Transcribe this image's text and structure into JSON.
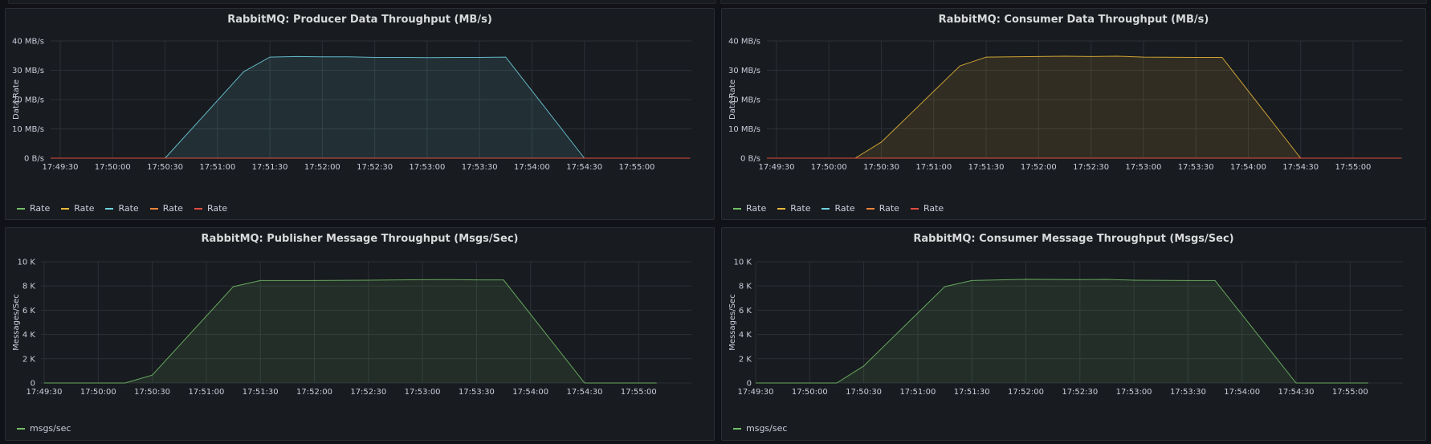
{
  "panels": [
    {
      "title": "RabbitMQ: Producer Data Throughput (MB/s)",
      "chart_data": {
        "type": "area",
        "ylabel": "Data Rate",
        "ylim": [
          0,
          40
        ],
        "y_ticks": [
          0,
          10,
          20,
          30,
          40
        ],
        "y_tick_labels": [
          "0 B/s",
          "10 MB/s",
          "20 MB/s",
          "30 MB/s",
          "40 MB/s"
        ],
        "x_tick_labels": [
          "17:49:30",
          "17:50:00",
          "17:50:30",
          "17:51:00",
          "17:51:30",
          "17:52:00",
          "17:52:30",
          "17:53:00",
          "17:53:30",
          "17:54:00",
          "17:54:30",
          "17:55:00"
        ],
        "series": [
          {
            "name": "Rate",
            "color": "#73bf69",
            "fill": false,
            "points": []
          },
          {
            "name": "Rate",
            "color": "#eab839",
            "fill": false,
            "points": []
          },
          {
            "name": "Rate",
            "color": "#6ed0e0",
            "fill": true,
            "points": [
              [
                "17:50:30",
                0
              ],
              [
                "17:51:15",
                29.5
              ],
              [
                "17:51:30",
                34.5
              ],
              [
                "17:51:45",
                34.7
              ],
              [
                "17:52:00",
                34.6
              ],
              [
                "17:52:15",
                34.6
              ],
              [
                "17:52:30",
                34.4
              ],
              [
                "17:52:45",
                34.4
              ],
              [
                "17:53:00",
                34.3
              ],
              [
                "17:53:15",
                34.4
              ],
              [
                "17:53:30",
                34.4
              ],
              [
                "17:53:45",
                34.5
              ],
              [
                "17:54:30",
                0
              ]
            ]
          },
          {
            "name": "Rate",
            "color": "#ef843c",
            "fill": false,
            "points": []
          },
          {
            "name": "Rate",
            "color": "#e24d42",
            "fill": false,
            "baseline": true,
            "points": [
              [
                "17:49:30",
                0
              ],
              [
                "17:55:10",
                0
              ]
            ]
          }
        ]
      }
    },
    {
      "title": "RabbitMQ: Consumer Data Throughput (MB/s)",
      "chart_data": {
        "type": "area",
        "ylabel": "Data Rate",
        "ylim": [
          0,
          40
        ],
        "y_ticks": [
          0,
          10,
          20,
          30,
          40
        ],
        "y_tick_labels": [
          "0 B/s",
          "10 MB/s",
          "20 MB/s",
          "30 MB/s",
          "40 MB/s"
        ],
        "x_tick_labels": [
          "17:49:30",
          "17:50:00",
          "17:50:30",
          "17:51:00",
          "17:51:30",
          "17:52:00",
          "17:52:30",
          "17:53:00",
          "17:53:30",
          "17:54:00",
          "17:54:30",
          "17:55:00"
        ],
        "series": [
          {
            "name": "Rate",
            "color": "#73bf69",
            "fill": false,
            "points": []
          },
          {
            "name": "Rate",
            "color": "#eab839",
            "fill": true,
            "points": [
              [
                "17:50:15",
                0
              ],
              [
                "17:50:30",
                5.5
              ],
              [
                "17:51:15",
                31.5
              ],
              [
                "17:51:30",
                34.5
              ],
              [
                "17:52:00",
                34.7
              ],
              [
                "17:52:15",
                34.8
              ],
              [
                "17:52:30",
                34.7
              ],
              [
                "17:52:45",
                34.8
              ],
              [
                "17:53:00",
                34.5
              ],
              [
                "17:53:30",
                34.4
              ],
              [
                "17:53:45",
                34.4
              ],
              [
                "17:54:30",
                0
              ]
            ]
          },
          {
            "name": "Rate",
            "color": "#6ed0e0",
            "fill": false,
            "points": []
          },
          {
            "name": "Rate",
            "color": "#ef843c",
            "fill": false,
            "points": []
          },
          {
            "name": "Rate",
            "color": "#e24d42",
            "fill": false,
            "baseline": true,
            "points": [
              [
                "17:49:30",
                0
              ],
              [
                "17:55:10",
                0
              ]
            ]
          }
        ]
      }
    },
    {
      "title": "RabbitMQ: Publisher Message Throughput (Msgs/Sec)",
      "chart_data": {
        "type": "area",
        "ylabel": "Messages/Sec",
        "ylim": [
          0,
          10000
        ],
        "y_ticks": [
          0,
          2000,
          4000,
          6000,
          8000,
          10000
        ],
        "y_tick_labels": [
          "0",
          "2 K",
          "4 K",
          "6 K",
          "8 K",
          "10 K"
        ],
        "x_tick_labels": [
          "17:49:30",
          "17:50:00",
          "17:50:30",
          "17:51:00",
          "17:51:30",
          "17:52:00",
          "17:52:30",
          "17:53:00",
          "17:53:30",
          "17:54:00",
          "17:54:30",
          "17:55:00"
        ],
        "series": [
          {
            "name": "msgs/sec",
            "color": "#73bf69",
            "fill": true,
            "points": [
              [
                "17:49:30",
                0
              ],
              [
                "17:50:15",
                0
              ],
              [
                "17:50:30",
                650
              ],
              [
                "17:51:15",
                7950
              ],
              [
                "17:51:30",
                8450
              ],
              [
                "17:52:00",
                8450
              ],
              [
                "17:52:30",
                8480
              ],
              [
                "17:53:00",
                8520
              ],
              [
                "17:53:15",
                8530
              ],
              [
                "17:53:30",
                8500
              ],
              [
                "17:53:45",
                8500
              ],
              [
                "17:54:30",
                0
              ],
              [
                "17:55:10",
                0
              ]
            ]
          }
        ]
      }
    },
    {
      "title": "RabbitMQ: Consumer Message Throughput (Msgs/Sec)",
      "chart_data": {
        "type": "area",
        "ylabel": "Messages/Sec",
        "ylim": [
          0,
          10000
        ],
        "y_ticks": [
          0,
          2000,
          4000,
          6000,
          8000,
          10000
        ],
        "y_tick_labels": [
          "0",
          "2 K",
          "4 K",
          "6 K",
          "8 K",
          "10 K"
        ],
        "x_tick_labels": [
          "17:49:30",
          "17:50:00",
          "17:50:30",
          "17:51:00",
          "17:51:30",
          "17:52:00",
          "17:52:30",
          "17:53:00",
          "17:53:30",
          "17:54:00",
          "17:54:30",
          "17:55:00"
        ],
        "series": [
          {
            "name": "msgs/sec",
            "color": "#73bf69",
            "fill": true,
            "points": [
              [
                "17:49:30",
                0
              ],
              [
                "17:50:15",
                0
              ],
              [
                "17:50:30",
                1400
              ],
              [
                "17:51:15",
                7950
              ],
              [
                "17:51:30",
                8450
              ],
              [
                "17:52:00",
                8550
              ],
              [
                "17:52:30",
                8530
              ],
              [
                "17:52:45",
                8540
              ],
              [
                "17:53:00",
                8480
              ],
              [
                "17:53:30",
                8450
              ],
              [
                "17:53:45",
                8450
              ],
              [
                "17:54:30",
                0
              ],
              [
                "17:55:10",
                0
              ]
            ]
          }
        ]
      }
    }
  ]
}
